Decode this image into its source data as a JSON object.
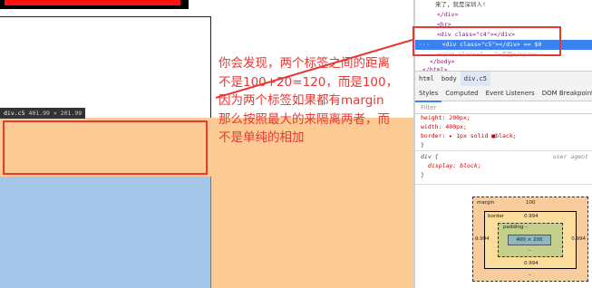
{
  "page": {
    "tooltip_name": "div.c5",
    "tooltip_dims": "401.99 × 201.99"
  },
  "annotation": {
    "text": "你会发现，两个标签之间的距离\n不是100+20=120，而是100，\n因为两个标签如果都有margin\n那么按照最大的来隔离两者，而\n不是单纯的相加"
  },
  "devtools": {
    "dom_lines": [
      {
        "indent": 2,
        "text": "来了，就是深圳人!"
      },
      {
        "indent": 1,
        "text": "</div>"
      },
      {
        "indent": 1,
        "text": "<hr>"
      },
      {
        "indent": 1,
        "text": "<div class=\"c4\"></div>"
      },
      {
        "indent": 1,
        "text": "<div class=\"c5\"></div> == $0",
        "selected": true
      },
      {
        "indent": 1,
        "text": "<span class=\"...\">点我</span>"
      },
      {
        "indent": 0,
        "text": "</body>"
      },
      {
        "indent": 0,
        "text": "</html>"
      }
    ],
    "breadcrumbs": [
      "html",
      "body",
      "div.c5"
    ],
    "tabs": [
      "Styles",
      "Computed",
      "Event Listeners",
      "DOM Breakpoints"
    ],
    "filter_placeholder": "Filter",
    "rule1": {
      "lines": [
        "height: 200px;",
        "width: 400px;",
        "border: ▸ 1px solid ■black;"
      ],
      "close": "}"
    },
    "rule2": {
      "selector": "div {",
      "source": "user agent",
      "prop": "display: block;",
      "close": "}"
    },
    "boxmodel": {
      "margin_label": "margin",
      "margin_top": "100",
      "margin_left": "–",
      "margin_right": "–",
      "margin_bottom": "–",
      "border_label": "border",
      "border_top": "0.994",
      "border_left": "0.994",
      "border_right": "0.994",
      "border_bottom": "0.994",
      "padding_label": "padding –",
      "padding_bottom": "–",
      "content": "400 × 200"
    }
  }
}
